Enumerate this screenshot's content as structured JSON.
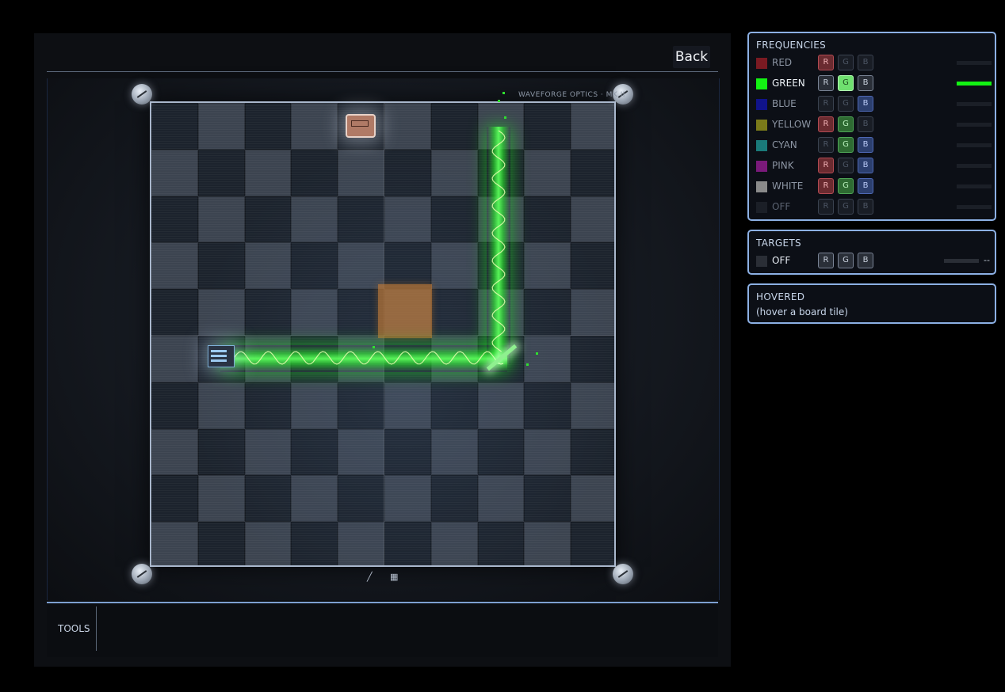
{
  "header": {
    "back_label": "Back"
  },
  "board": {
    "brand": "WAVEFORGE OPTICS · MK II",
    "beam_color": "#13f313",
    "crate_color": "#b8763a",
    "tool_icons": [
      "pencil-icon",
      "grid-icon"
    ]
  },
  "tools": {
    "label": "TOOLS"
  },
  "frequencies": {
    "title": "FREQUENCIES",
    "items": [
      {
        "name": "RED",
        "color": "#7a1a22",
        "r": true,
        "g": false,
        "b": false,
        "level": 0,
        "active": false
      },
      {
        "name": "GREEN",
        "color": "#13f313",
        "r": false,
        "g": true,
        "b": false,
        "level": 1,
        "active": true
      },
      {
        "name": "BLUE",
        "color": "#10138a",
        "r": false,
        "g": false,
        "b": true,
        "level": 0,
        "active": false
      },
      {
        "name": "YELLOW",
        "color": "#7a7a1a",
        "r": true,
        "g": true,
        "b": false,
        "level": 0,
        "active": false
      },
      {
        "name": "CYAN",
        "color": "#1a7a7a",
        "r": false,
        "g": true,
        "b": true,
        "level": 0,
        "active": false
      },
      {
        "name": "PINK",
        "color": "#7a1a7a",
        "r": true,
        "g": false,
        "b": true,
        "level": 0,
        "active": false
      },
      {
        "name": "WHITE",
        "color": "#8a8a8a",
        "r": true,
        "g": true,
        "b": true,
        "level": 0,
        "active": false
      },
      {
        "name": "OFF",
        "color": "#1b1f27",
        "r": false,
        "g": false,
        "b": false,
        "level": 0,
        "active": false
      }
    ]
  },
  "targets": {
    "title": "TARGETS",
    "items": [
      {
        "name": "OFF",
        "color": "#2a2e36",
        "value": "--"
      }
    ]
  },
  "hovered": {
    "title": "HOVERED",
    "text": "(hover a board tile)"
  },
  "channel_labels": {
    "r": "R",
    "g": "G",
    "b": "B"
  }
}
